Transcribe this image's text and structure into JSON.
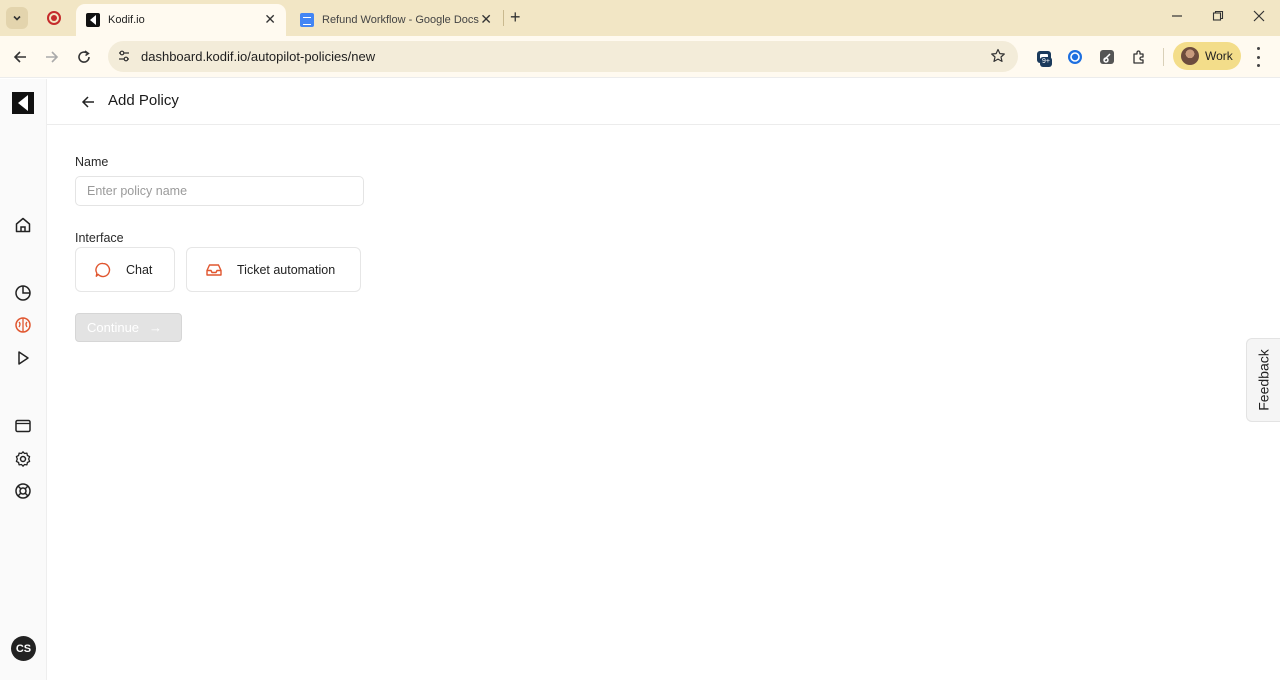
{
  "browser": {
    "tabs": [
      {
        "title": "Kodif.io",
        "active": true
      },
      {
        "title": "Refund Workflow - Google Docs",
        "active": false
      }
    ],
    "url": "dashboard.kodif.io/autopilot-policies/new",
    "extension_badge": "9+",
    "profile_label": "Work"
  },
  "sidebar": {
    "items": [
      "home-icon",
      "analytics-icon",
      "brain-icon",
      "play-icon",
      "window-icon",
      "settings-icon",
      "support-icon"
    ],
    "active_item": "brain-icon",
    "user_initials": "CS"
  },
  "page": {
    "title": "Add Policy",
    "name_label": "Name",
    "name_value": "",
    "name_placeholder": "Enter policy name",
    "interface_label": "Interface",
    "options": [
      {
        "label": "Chat",
        "icon": "chat-bubble-icon"
      },
      {
        "label": "Ticket automation",
        "icon": "inbox-tray-icon"
      }
    ],
    "continue_label": "Continue",
    "continue_disabled": true,
    "feedback_label": "Feedback"
  },
  "colors": {
    "accent": "#e0562f",
    "tabbar_bg": "#f2e6c5",
    "disabled_button_bg": "#e3e3e3"
  }
}
